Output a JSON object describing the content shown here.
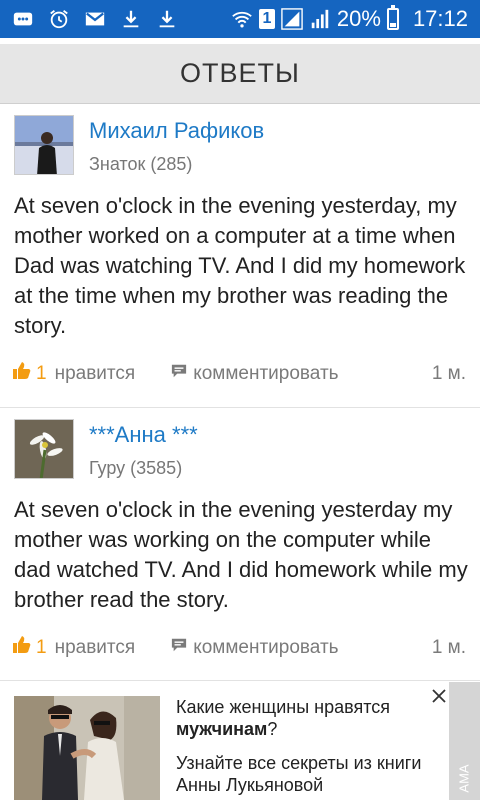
{
  "status_bar": {
    "sim_number": "1",
    "battery": "20%",
    "battery_level": 0.2,
    "time": "17:12",
    "icons": [
      "messages-icon",
      "alarm-icon",
      "gmail-icon",
      "download-icon",
      "download-icon",
      "wifi-icon",
      "sim-badge",
      "signal-icon",
      "signal-icon",
      "battery-icon"
    ]
  },
  "header": {
    "title": "ОТВЕТЫ"
  },
  "answers": [
    {
      "name": "Михаил Рафиков",
      "rank": "Знаток (285)",
      "text": "At seven o'clock in the evening yesterday, my mother worked on a computer at a time when Dad was watching TV. And I did my homework at the time when my brother was reading the story.",
      "likes": "1",
      "like_label": "нравится",
      "comment_label": "комментировать",
      "time": "1 м."
    },
    {
      "name": "***Анна ***",
      "rank": "Гуру (3585)",
      "text": "At seven o'clock in the evening yesterday my mother was working on the computer while dad watched TV. And I did homework while my brother read the story.",
      "likes": "1",
      "like_label": "нравится",
      "comment_label": "комментировать",
      "time": "1 м."
    }
  ],
  "ad": {
    "title_prefix": "Какие женщины нравятся",
    "title_bold": "мужчинам",
    "title_suffix": "?",
    "text": "Узнайте все секреты из книги Анны Лукьяновой",
    "side_label": "АМА"
  },
  "colors": {
    "status_bar": "#1565c0",
    "link": "#1e7ac6",
    "like": "#f39c12"
  }
}
